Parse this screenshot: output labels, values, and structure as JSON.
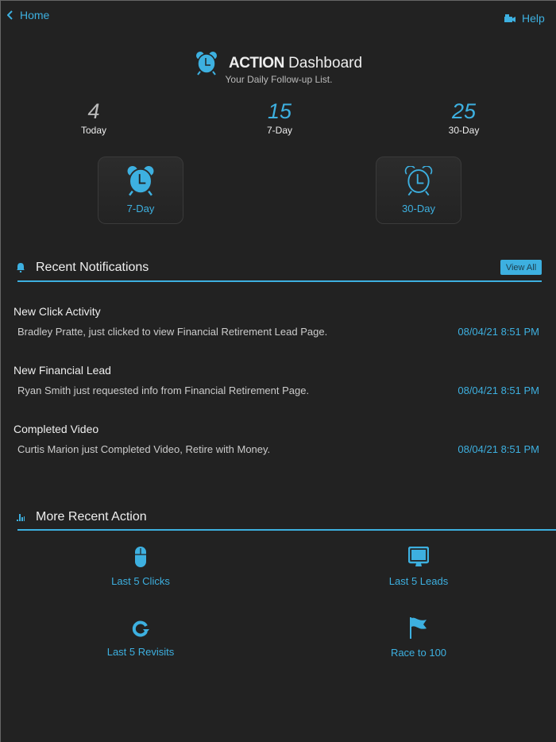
{
  "nav": {
    "home": "Home",
    "help": "Help"
  },
  "header": {
    "title_bold": "ACTION",
    "title_rest": "Dashboard",
    "subtitle": "Your Daily Follow-up List."
  },
  "stats": [
    {
      "value": "4",
      "label": "Today"
    },
    {
      "value": "15",
      "label": "7-Day"
    },
    {
      "value": "25",
      "label": "30-Day"
    }
  ],
  "tiles": [
    {
      "label": "7-Day"
    },
    {
      "label": "30-Day"
    }
  ],
  "notifications": {
    "heading": "Recent Notifications",
    "view_all": "View All",
    "items": [
      {
        "title": "New Click Activity",
        "message": "Bradley Pratte, just clicked to view Financial Retirement Lead Page.",
        "time": "08/04/21 8:51 PM"
      },
      {
        "title": "New Financial Lead",
        "message": "Ryan Smith just requested info from Financial Retirement Page.",
        "time": "08/04/21 8:51 PM"
      },
      {
        "title": "Completed Video",
        "message": "Curtis Marion just Completed Video, Retire with Money.",
        "time": "08/04/21 8:51 PM"
      }
    ]
  },
  "more": {
    "heading": "More Recent Action",
    "items": [
      {
        "label": "Last 5 Clicks",
        "icon": "mouse-icon"
      },
      {
        "label": "Last 5 Leads",
        "icon": "monitor-icon"
      },
      {
        "label": "Last 5 Revisits",
        "icon": "refresh-icon"
      },
      {
        "label": "Race to 100",
        "icon": "flag-icon"
      }
    ]
  },
  "colors": {
    "accent": "#3db0e0",
    "background": "#222222"
  }
}
